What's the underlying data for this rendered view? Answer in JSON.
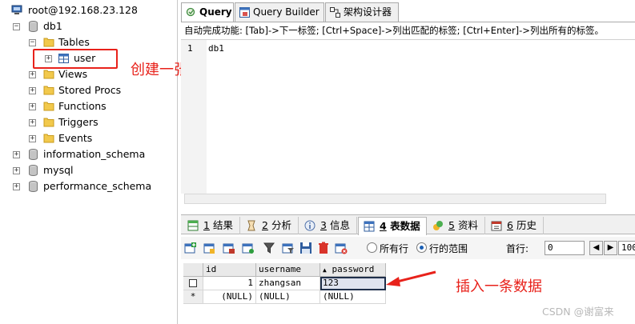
{
  "tree": {
    "server": "root@192.168.23.128",
    "db": "db1",
    "tables_folder": "Tables",
    "table_user": "user",
    "views": "Views",
    "procs": "Stored Procs",
    "functions": "Functions",
    "triggers": "Triggers",
    "events": "Events",
    "db_info": "information_schema",
    "db_mysql": "mysql",
    "db_perf": "performance_schema",
    "collapsed_sign": "+",
    "expanded_sign": "−"
  },
  "annotations": {
    "create_table": "创建一张表",
    "insert_row": "插入一条数据",
    "accent": "#e8221b"
  },
  "query_tabs": [
    "Query",
    "Query Builder",
    "架构设计器"
  ],
  "hint": "自动完成功能: [Tab]->下一标签; [Ctrl+Space]->列出匹配的标签; [Ctrl+Enter]->列出所有的标签。",
  "editor": {
    "line_no": "1",
    "code": "db1"
  },
  "result_tabs": [
    {
      "num": "1",
      "label": "结果"
    },
    {
      "num": "2",
      "label": "分析"
    },
    {
      "num": "3",
      "label": "信息"
    },
    {
      "num": "4",
      "label": "表数据"
    },
    {
      "num": "5",
      "label": "资料"
    },
    {
      "num": "6",
      "label": "历史"
    }
  ],
  "toolbar": {
    "all_rows": "所有行",
    "row_range": "行的范围",
    "start_row_label": "首行:",
    "start_row_value": "0",
    "limit_value": "100"
  },
  "grid": {
    "columns": [
      "id",
      "username",
      "password"
    ],
    "sort_marker": "▲",
    "row1": {
      "id": "1",
      "username": "zhangsan",
      "password": "123"
    },
    "new_row": {
      "marker": "*",
      "id": "(NULL)",
      "username": "(NULL)",
      "password": "(NULL)"
    }
  },
  "watermark": "CSDN @谢富来"
}
